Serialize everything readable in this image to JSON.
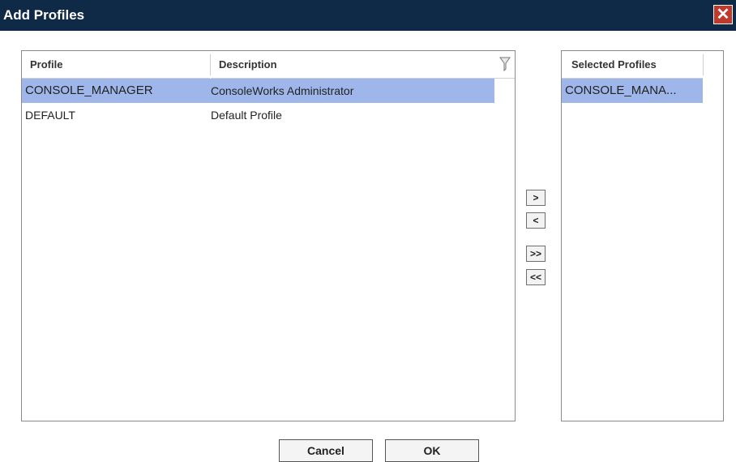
{
  "dialog": {
    "title": "Add Profiles",
    "close_glyph": "✕"
  },
  "available": {
    "columns": [
      "Profile",
      "Description"
    ],
    "rows": [
      {
        "profile": "CONSOLE_MANAGER",
        "description": "ConsoleWorks Administrator",
        "selected": true
      },
      {
        "profile": "DEFAULT",
        "description": "Default Profile",
        "selected": false
      }
    ]
  },
  "selected_list": {
    "header": "Selected Profiles",
    "items": [
      "CONSOLE_MANA..."
    ]
  },
  "transfer_buttons": {
    "move_right": ">",
    "move_left": "<",
    "move_all_right": ">>",
    "move_all_left": "<<"
  },
  "footer": {
    "cancel_label": "Cancel",
    "ok_label": "OK"
  },
  "colors": {
    "titlebar": "#0f2a46",
    "selection": "#9eb6ea",
    "close": "#c0392b"
  }
}
